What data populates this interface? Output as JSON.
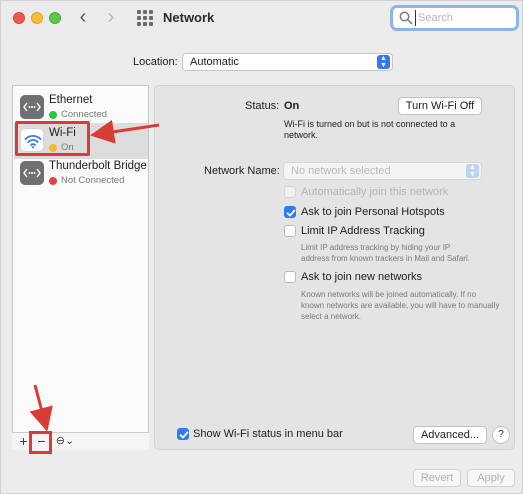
{
  "window": {
    "title": "Network",
    "search_placeholder": "Search"
  },
  "location": {
    "label": "Location:",
    "value": "Automatic"
  },
  "sidebar": {
    "items": [
      {
        "name": "Ethernet",
        "status": "Connected",
        "status_color": "#28c840",
        "icon": "ethernet-icon"
      },
      {
        "name": "Wi-Fi",
        "status": "On",
        "status_color": "#f5b82e",
        "icon": "wifi-icon"
      },
      {
        "name": "Thunderbolt Bridge",
        "status": "Not Connected",
        "status_color": "#e5443b",
        "icon": "thunderbolt-bridge-icon"
      }
    ],
    "add_label": "+",
    "remove_label": "−",
    "action_label": "⊖⌄"
  },
  "status": {
    "label": "Status:",
    "value": "On",
    "toggle_button": "Turn Wi-Fi Off",
    "description": "Wi-Fi is turned on but is not connected to a network."
  },
  "network_name": {
    "label": "Network Name:",
    "placeholder": "No network selected"
  },
  "options": {
    "auto_join": {
      "label": "Automatically join this network",
      "checked": false,
      "enabled": false
    },
    "ask_hotspots": {
      "label": "Ask to join Personal Hotspots",
      "checked": true
    },
    "limit_tracking": {
      "label": "Limit IP Address Tracking",
      "checked": false,
      "help": "Limit IP address tracking by hiding your IP address from known trackers in Mail and Safari."
    },
    "ask_new_networks": {
      "label": "Ask to join new networks",
      "checked": false,
      "help": "Known networks will be joined automatically. If no known networks are available, you will have to manually select a network."
    },
    "show_menu_bar": {
      "label": "Show Wi-Fi status in menu bar",
      "checked": true
    }
  },
  "buttons": {
    "advanced": "Advanced...",
    "help": "?",
    "revert": "Revert",
    "apply": "Apply"
  },
  "colors": {
    "accent": "#2f7bf5",
    "annotation": "#d93b36"
  }
}
